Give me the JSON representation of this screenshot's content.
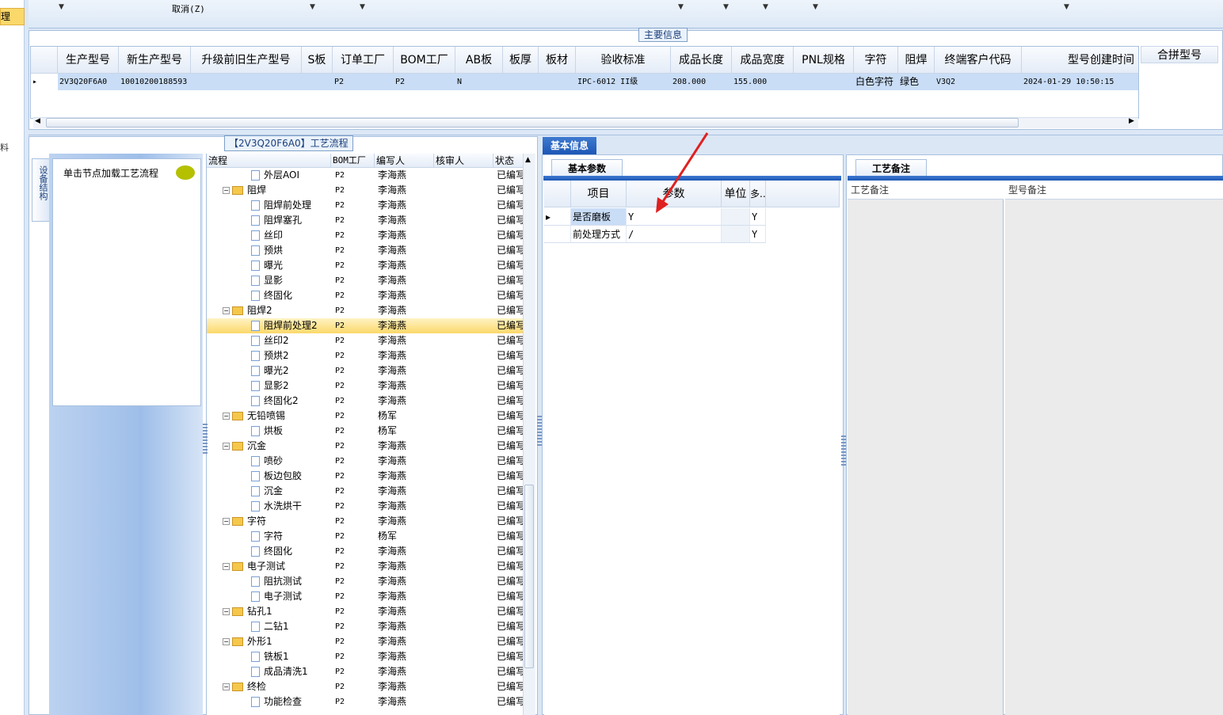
{
  "left_nav": {
    "selected_label": "理",
    "chars": [
      "料"
    ]
  },
  "toolbar": {
    "cancel_label": "取消(Z)"
  },
  "main_info": {
    "legend": "主要信息",
    "columns": [
      "生产型号",
      "新生产型号",
      "升级前旧生产型号",
      "S板",
      "订单工厂",
      "BOM工厂",
      "AB板",
      "板厚",
      "板材",
      "验收标准",
      "成品长度",
      "成品宽度",
      "PNL规格",
      "字符",
      "阻焊",
      "终端客户代码",
      "型号创建时间"
    ],
    "row": [
      "2V3Q20F6A0",
      "10010200188593",
      "",
      "",
      "P2",
      "P2",
      "N",
      "",
      "",
      "IPC-6012 II级",
      "208.000",
      "155.000",
      "",
      "白色字符",
      "绿色",
      "V3Q2",
      "2024-01-29 10:50:15"
    ],
    "merge_header": "合拼型号"
  },
  "process": {
    "legend": "【2V3Q20F6A0】工艺流程",
    "side_tab": "设备结构",
    "node_hint": "单击节点加载工艺流程",
    "columns": [
      "流程",
      "BOM工厂",
      "编写人",
      "核审人",
      "状态"
    ],
    "rows": [
      {
        "name": "外层AOI",
        "factory": "P2",
        "writer": "李海燕",
        "status": "已编写",
        "level": 2,
        "folder": false
      },
      {
        "name": "阻焊",
        "factory": "P2",
        "writer": "李海燕",
        "status": "已编写",
        "level": 1,
        "folder": true
      },
      {
        "name": "阻焊前处理",
        "factory": "P2",
        "writer": "李海燕",
        "status": "已编写",
        "level": 2,
        "folder": false
      },
      {
        "name": "阻焊塞孔",
        "factory": "P2",
        "writer": "李海燕",
        "status": "已编写",
        "level": 2,
        "folder": false
      },
      {
        "name": "丝印",
        "factory": "P2",
        "writer": "李海燕",
        "status": "已编写",
        "level": 2,
        "folder": false
      },
      {
        "name": "预烘",
        "factory": "P2",
        "writer": "李海燕",
        "status": "已编写",
        "level": 2,
        "folder": false
      },
      {
        "name": "曝光",
        "factory": "P2",
        "writer": "李海燕",
        "status": "已编写",
        "level": 2,
        "folder": false
      },
      {
        "name": "显影",
        "factory": "P2",
        "writer": "李海燕",
        "status": "已编写",
        "level": 2,
        "folder": false
      },
      {
        "name": "终固化",
        "factory": "P2",
        "writer": "李海燕",
        "status": "已编写",
        "level": 2,
        "folder": false
      },
      {
        "name": "阻焊2",
        "factory": "P2",
        "writer": "李海燕",
        "status": "已编写",
        "level": 1,
        "folder": true
      },
      {
        "name": "阻焊前处理2",
        "factory": "P2",
        "writer": "李海燕",
        "status": "已编写",
        "level": 2,
        "folder": false,
        "selected": true
      },
      {
        "name": "丝印2",
        "factory": "P2",
        "writer": "李海燕",
        "status": "已编写",
        "level": 2,
        "folder": false
      },
      {
        "name": "预烘2",
        "factory": "P2",
        "writer": "李海燕",
        "status": "已编写",
        "level": 2,
        "folder": false
      },
      {
        "name": "曝光2",
        "factory": "P2",
        "writer": "李海燕",
        "status": "已编写",
        "level": 2,
        "folder": false
      },
      {
        "name": "显影2",
        "factory": "P2",
        "writer": "李海燕",
        "status": "已编写",
        "level": 2,
        "folder": false
      },
      {
        "name": "终固化2",
        "factory": "P2",
        "writer": "李海燕",
        "status": "已编写",
        "level": 2,
        "folder": false
      },
      {
        "name": "无铅喷锡",
        "factory": "P2",
        "writer": "杨军",
        "status": "已编写",
        "level": 1,
        "folder": true
      },
      {
        "name": "烘板",
        "factory": "P2",
        "writer": "杨军",
        "status": "已编写",
        "level": 2,
        "folder": false
      },
      {
        "name": "沉金",
        "factory": "P2",
        "writer": "李海燕",
        "status": "已编写",
        "level": 1,
        "folder": true
      },
      {
        "name": "喷砂",
        "factory": "P2",
        "writer": "李海燕",
        "status": "已编写",
        "level": 2,
        "folder": false
      },
      {
        "name": "板边包胶",
        "factory": "P2",
        "writer": "李海燕",
        "status": "已编写",
        "level": 2,
        "folder": false
      },
      {
        "name": "沉金",
        "factory": "P2",
        "writer": "李海燕",
        "status": "已编写",
        "level": 2,
        "folder": false
      },
      {
        "name": "水洗烘干",
        "factory": "P2",
        "writer": "李海燕",
        "status": "已编写",
        "level": 2,
        "folder": false
      },
      {
        "name": "字符",
        "factory": "P2",
        "writer": "李海燕",
        "status": "已编写",
        "level": 1,
        "folder": true
      },
      {
        "name": "字符",
        "factory": "P2",
        "writer": "杨军",
        "status": "已编写",
        "level": 2,
        "folder": false
      },
      {
        "name": "终固化",
        "factory": "P2",
        "writer": "李海燕",
        "status": "已编写",
        "level": 2,
        "folder": false
      },
      {
        "name": "电子测试",
        "factory": "P2",
        "writer": "李海燕",
        "status": "已编写",
        "level": 1,
        "folder": true
      },
      {
        "name": "阻抗测试",
        "factory": "P2",
        "writer": "李海燕",
        "status": "已编写",
        "level": 2,
        "folder": false
      },
      {
        "name": "电子测试",
        "factory": "P2",
        "writer": "李海燕",
        "status": "已编写",
        "level": 2,
        "folder": false
      },
      {
        "name": "钻孔1",
        "factory": "P2",
        "writer": "李海燕",
        "status": "已编写",
        "level": 1,
        "folder": true
      },
      {
        "name": "二钻1",
        "factory": "P2",
        "writer": "李海燕",
        "status": "已编写",
        "level": 2,
        "folder": false
      },
      {
        "name": "外形1",
        "factory": "P2",
        "writer": "李海燕",
        "status": "已编写",
        "level": 1,
        "folder": true
      },
      {
        "name": "铣板1",
        "factory": "P2",
        "writer": "李海燕",
        "status": "已编写",
        "level": 2,
        "folder": false
      },
      {
        "name": "成品清洗1",
        "factory": "P2",
        "writer": "李海燕",
        "status": "已编写",
        "level": 2,
        "folder": false
      },
      {
        "name": "终检",
        "factory": "P2",
        "writer": "李海燕",
        "status": "已编写",
        "level": 1,
        "folder": true
      },
      {
        "name": "功能检查",
        "factory": "P2",
        "writer": "李海燕",
        "status": "已编写",
        "level": 2,
        "folder": false
      }
    ]
  },
  "basic_info": {
    "tab": "基本信息",
    "param_tab": "基本参数",
    "columns": [
      "项目",
      "参数",
      "单位",
      "多.."
    ],
    "rows": [
      {
        "item": "是否磨板",
        "value": "Y",
        "unit": "",
        "multi": "Y"
      },
      {
        "item": "前处理方式",
        "value": "/",
        "unit": "",
        "multi": "Y"
      }
    ]
  },
  "notes": {
    "tab": "工艺备注",
    "process_note": "工艺备注",
    "model_note": "型号备注"
  },
  "colors": {
    "accent": "#1d57b5",
    "selected_row": "#fbd86a",
    "grid_row": "#c9ddf6",
    "arrow": "#e02020"
  }
}
